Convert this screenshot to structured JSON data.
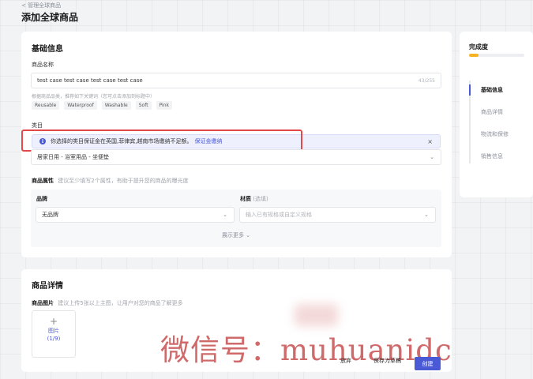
{
  "breadcrumb": "< 管理全球商品",
  "page_title": "添加全球商品",
  "basic": {
    "title": "基础信息",
    "product_name_label": "商品名称",
    "product_name_value": "test  case test  case test  case test  case",
    "product_name_counter": "43/255",
    "keyword_hint": "根据商品品类，推荐如下关键词（您可点击添加到标题中）",
    "keywords": [
      "Reusable",
      "Waterproof",
      "Washable",
      "Soft",
      "Pink"
    ],
    "category_label": "类目",
    "notice_text": "你选择的类目保证金在英国,菲律宾,越南市场缴纳不足额。",
    "notice_link": "保证金缴纳",
    "notice_close": "×",
    "category_value": "居家日用 - 浴室用品 - 坐便垫",
    "attr_label": "商品属性",
    "attr_hint": "建议至少填写2个属性，有助于提升您的商品的曝光度",
    "brand_label": "品牌",
    "brand_value": "无品牌",
    "material_label": "材质",
    "material_optional": "(选填)",
    "material_placeholder": "输入已有规格或自定义规格",
    "show_more": "展示更多 ⌄"
  },
  "detail": {
    "title": "商品详情",
    "images_label": "商品图片",
    "images_hint": "建议上传5张以上主图，让用户对您的商品了解更多",
    "upload_plus": "+",
    "upload_label": "图片",
    "upload_count": "(1/9)"
  },
  "sidebar": {
    "completion_label": "完成度",
    "completion_progress": 0.17,
    "items": [
      "基础信息",
      "商品详情",
      "物流和保修",
      "销售信息"
    ],
    "active_index": 0
  },
  "footer": {
    "abandon": "放弃",
    "save_draft": "保存为草稿",
    "create": "创建"
  },
  "watermark": "微信号：muhuanidc",
  "colors": {
    "accent": "#4a59d6",
    "highlight_box": "#e24a4a",
    "progress": "#f5b321"
  }
}
